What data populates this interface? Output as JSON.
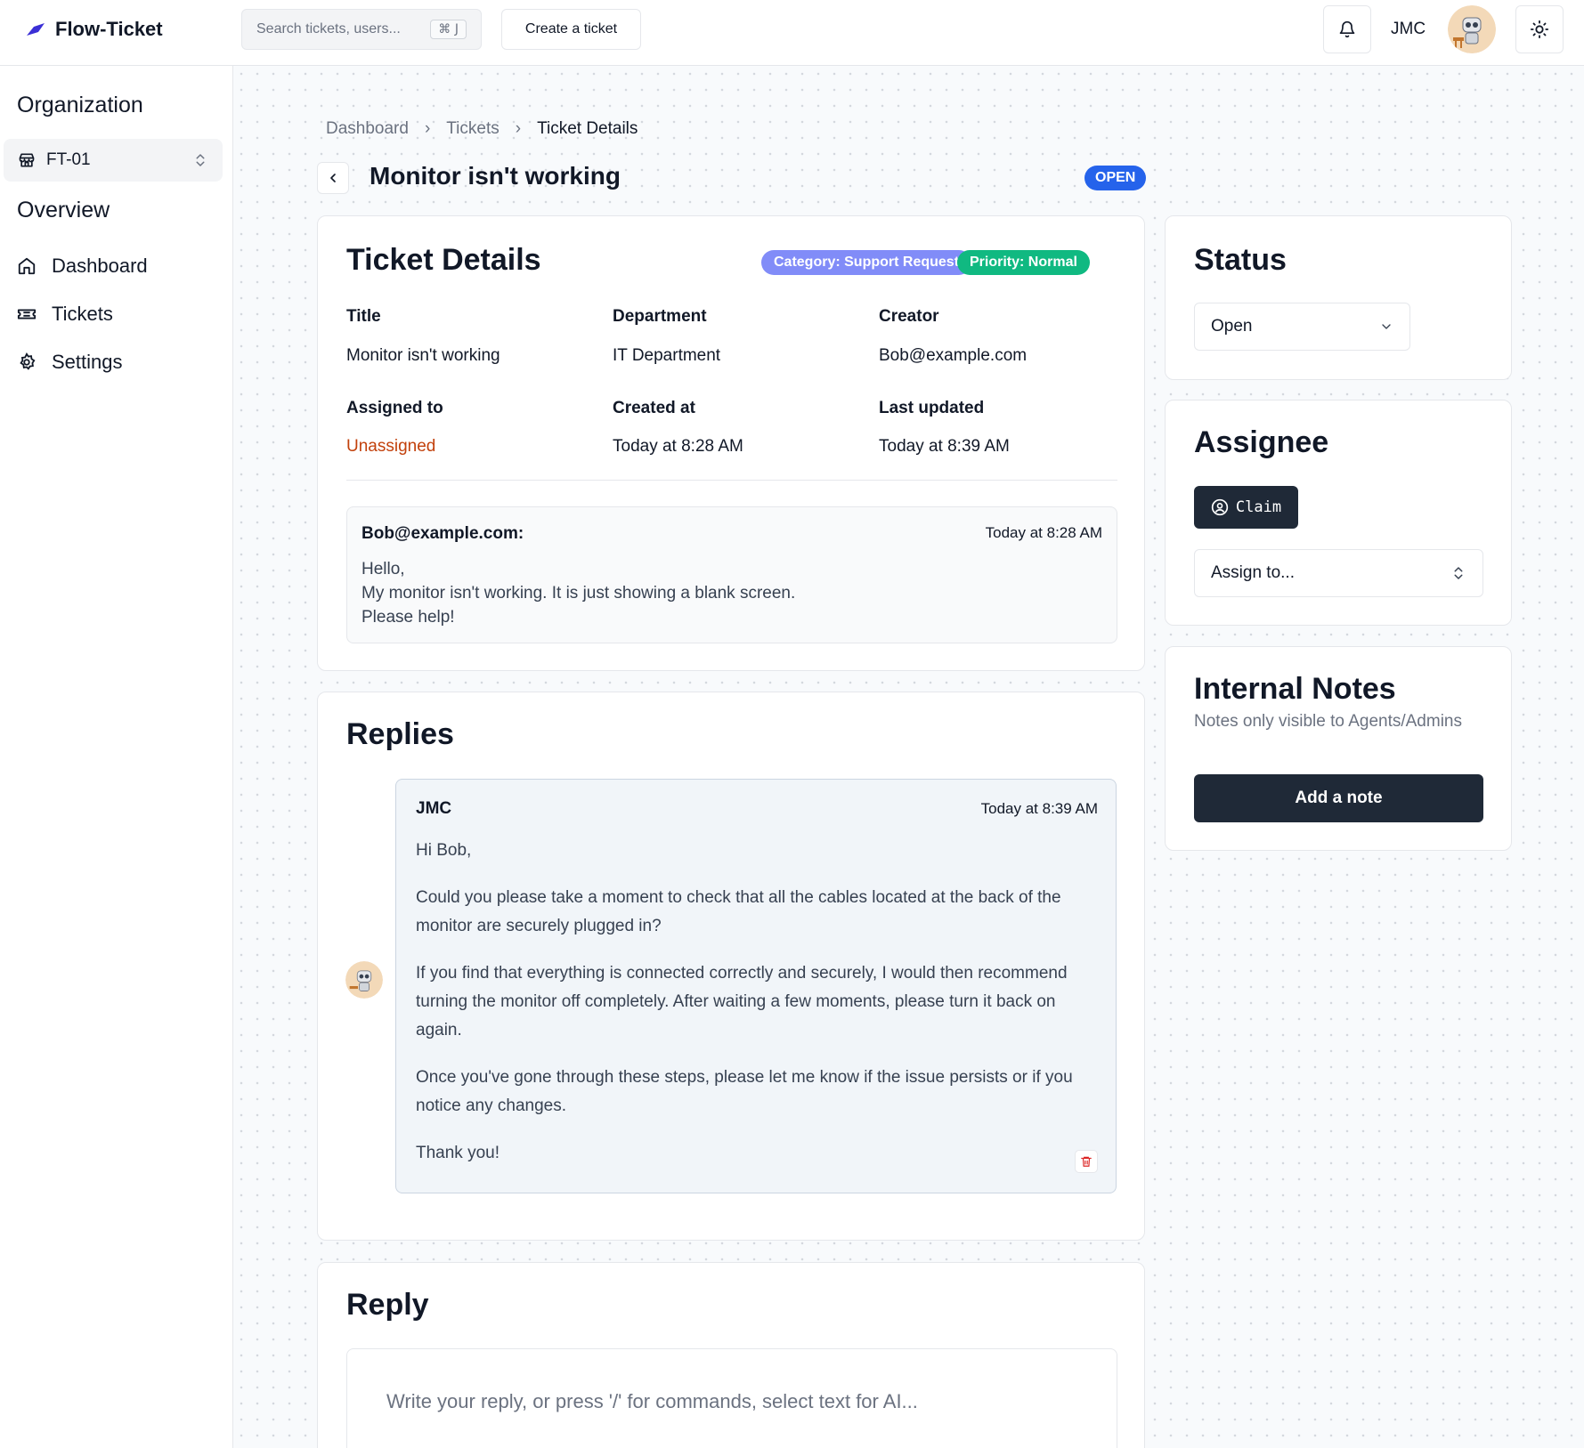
{
  "app": {
    "name": "Flow-Ticket"
  },
  "header": {
    "search_placeholder": "Search tickets, users...",
    "search_shortcut": "⌘ J",
    "create_label": "Create a ticket",
    "user_initials": "JMC"
  },
  "sidebar": {
    "org_heading": "Organization",
    "org_value": "FT-01",
    "overview_heading": "Overview",
    "items": [
      {
        "label": "Dashboard",
        "icon": "home-icon"
      },
      {
        "label": "Tickets",
        "icon": "ticket-icon"
      },
      {
        "label": "Settings",
        "icon": "gear-icon"
      }
    ]
  },
  "breadcrumb": [
    "Dashboard",
    "Tickets",
    "Ticket Details"
  ],
  "page": {
    "title": "Monitor isn't working",
    "status_badge": "OPEN"
  },
  "details": {
    "heading": "Ticket Details",
    "category_badge": "Category: Support Request",
    "priority_badge": "Priority: Normal",
    "fields": [
      {
        "label": "Title",
        "value": "Monitor isn't working"
      },
      {
        "label": "Department",
        "value": "IT Department"
      },
      {
        "label": "Creator",
        "value": "Bob@example.com"
      },
      {
        "label": "Assigned to",
        "value": "Unassigned"
      },
      {
        "label": "Created at",
        "value": "Today at 8:28 AM"
      },
      {
        "label": "Last updated",
        "value": "Today at 8:39 AM"
      }
    ],
    "message": {
      "from": "Bob@example.com:",
      "time": "Today at 8:28 AM",
      "lines": [
        "Hello,",
        "My monitor isn't working. It is just showing a blank screen.",
        "Please help!"
      ]
    }
  },
  "replies": {
    "heading": "Replies",
    "items": [
      {
        "from": "JMC",
        "time": "Today at 8:39 AM",
        "paragraphs": [
          "Hi Bob,",
          "Could you please take a moment to check that all the cables located at the back of the monitor are securely plugged in?",
          "If you find that everything is connected correctly and securely, I would then recommend turning the monitor off completely. After waiting a few moments, please turn it back on again.",
          "Once you've gone through these steps, please let me know if the issue persists or if you notice any changes.",
          "Thank you!"
        ]
      }
    ]
  },
  "reply": {
    "heading": "Reply",
    "placeholder": "Write your reply, or press '/' for commands, select text for AI..."
  },
  "status": {
    "heading": "Status",
    "value": "Open"
  },
  "assignee": {
    "heading": "Assignee",
    "claim_label": "Claim",
    "assign_placeholder": "Assign to..."
  },
  "notes": {
    "heading": "Internal Notes",
    "subtitle": "Notes only visible to Agents/Admins",
    "add_label": "Add a note"
  },
  "colors": {
    "open_badge": "#2563eb",
    "category_badge": "#818cf8",
    "priority_badge": "#10b981",
    "unassigned_text": "#c2410c",
    "dark_button": "#1f2937",
    "brand_logo": "#3b2fd6"
  }
}
